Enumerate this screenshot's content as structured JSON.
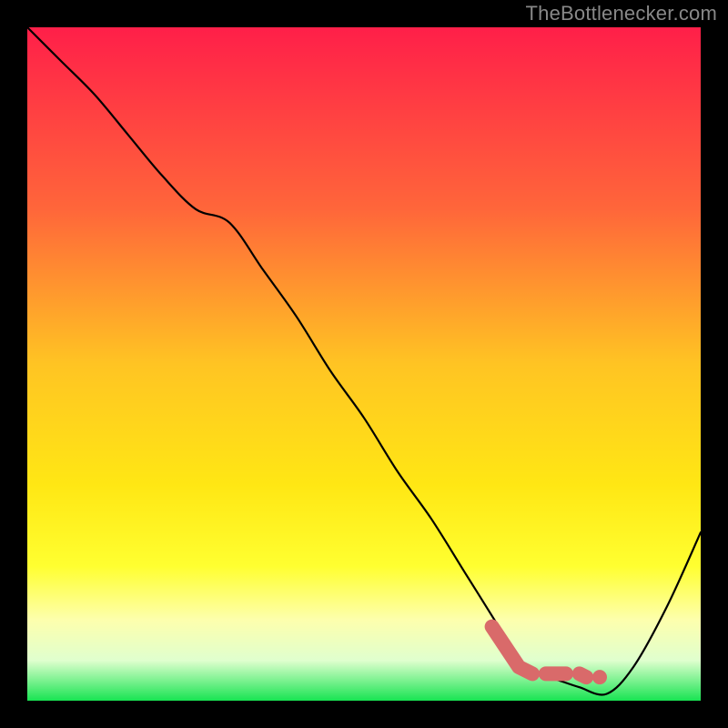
{
  "watermark": "TheBottlenecker.com",
  "chart_data": {
    "type": "line",
    "title": "",
    "xlabel": "",
    "ylabel": "",
    "xlim": [
      0,
      100
    ],
    "ylim": [
      0,
      100
    ],
    "gradient_stops": [
      {
        "offset": 0,
        "color": "#ff1f49"
      },
      {
        "offset": 27,
        "color": "#ff663a"
      },
      {
        "offset": 50,
        "color": "#ffc423"
      },
      {
        "offset": 68,
        "color": "#ffe714"
      },
      {
        "offset": 80,
        "color": "#ffff30"
      },
      {
        "offset": 88,
        "color": "#fdffad"
      },
      {
        "offset": 94,
        "color": "#e0ffce"
      },
      {
        "offset": 100,
        "color": "#18e452"
      }
    ],
    "series": [
      {
        "name": "bottleneck-curve",
        "x": [
          0,
          5,
          10,
          15,
          20,
          25,
          30,
          35,
          40,
          45,
          50,
          55,
          60,
          65,
          70,
          73,
          76,
          79,
          82,
          86,
          90,
          95,
          100
        ],
        "y": [
          100,
          95,
          90,
          84,
          78,
          73,
          71,
          64,
          57,
          49,
          42,
          34,
          27,
          19,
          11,
          6,
          4,
          3,
          2,
          1,
          5,
          14,
          25
        ]
      }
    ],
    "highlight_segments": [
      {
        "x": [
          69,
          73,
          75
        ],
        "y": [
          11,
          5,
          4
        ]
      },
      {
        "x": [
          77,
          80
        ],
        "y": [
          4,
          4
        ]
      },
      {
        "x": [
          82,
          83
        ],
        "y": [
          4,
          3.5
        ]
      }
    ],
    "highlight_point": {
      "x": 85,
      "y": 3.5
    }
  }
}
